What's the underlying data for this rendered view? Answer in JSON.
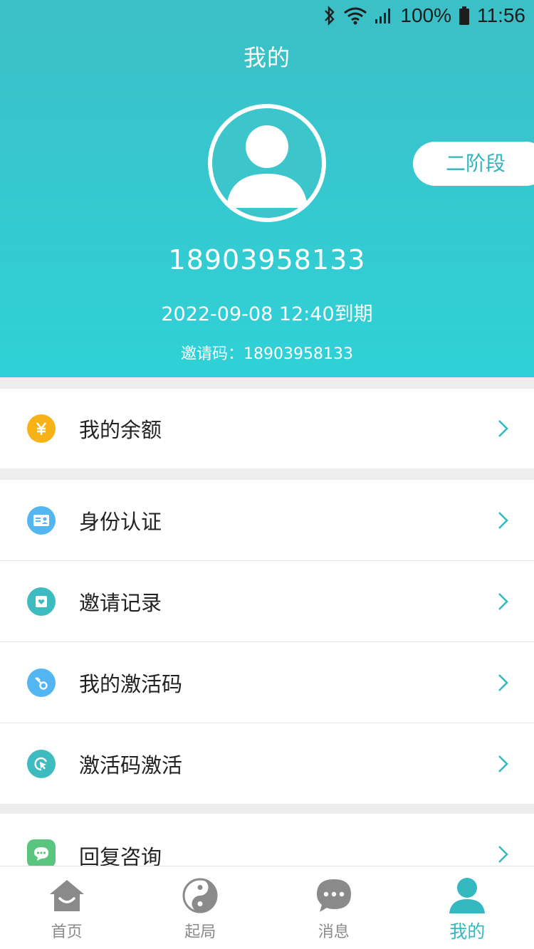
{
  "status_bar": {
    "battery": "100%",
    "time": "11:56"
  },
  "header": {
    "title": "我的",
    "stage_badge": "二阶段",
    "phone": "18903958133",
    "expire_text": "2022-09-08 12:40到期",
    "invite_code": "邀请码：18903958133"
  },
  "menu": {
    "balance": "我的余额",
    "identity": "身份认证",
    "invite_records": "邀请记录",
    "my_activation_codes": "我的激活码",
    "activate_code": "激活码激活",
    "reply_consult": "回复咨询"
  },
  "tabbar": {
    "home": "首页",
    "qiju": "起局",
    "messages": "消息",
    "mine": "我的"
  },
  "colors": {
    "accent": "#34b9c0",
    "balance_icon": "#f7b316",
    "identity_icon": "#53b6f0",
    "invite_icon": "#3dbbbf",
    "key_icon": "#53b6f0",
    "activate_icon": "#3dbbbf",
    "reply_icon": "#59c57f"
  }
}
